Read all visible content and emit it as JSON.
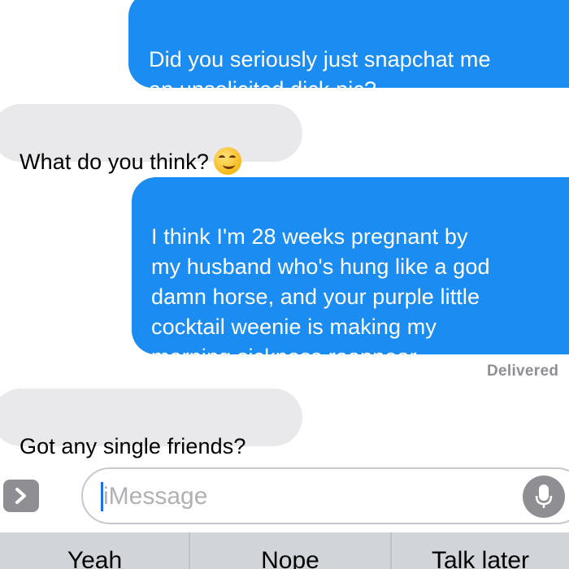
{
  "messages": [
    {
      "from": "me",
      "text": "Did you seriously just snapchat me\nan unsolicited dick pic?"
    },
    {
      "from": "them",
      "text": "What do you think?",
      "emoji": "smirking-face-emoji"
    },
    {
      "from": "me",
      "text": "I think I'm 28 weeks pregnant by\nmy husband who's hung like a god\ndamn horse, and your purple little\ncocktail weenie is making my\nmorning sickness reappear."
    },
    {
      "from": "them",
      "text": "Got any single friends?"
    }
  ],
  "status": {
    "delivered": "Delivered"
  },
  "composer": {
    "placeholder": "iMessage",
    "expand_icon": "chevron-right-icon",
    "mic_icon": "microphone-icon"
  },
  "suggestions": [
    "Yeah",
    "Nope",
    "Talk later"
  ],
  "colors": {
    "sent_bubble": "#1b8cf1",
    "received_bubble": "#e9e9eb",
    "suggestion_bar": "#d1d4d9"
  }
}
